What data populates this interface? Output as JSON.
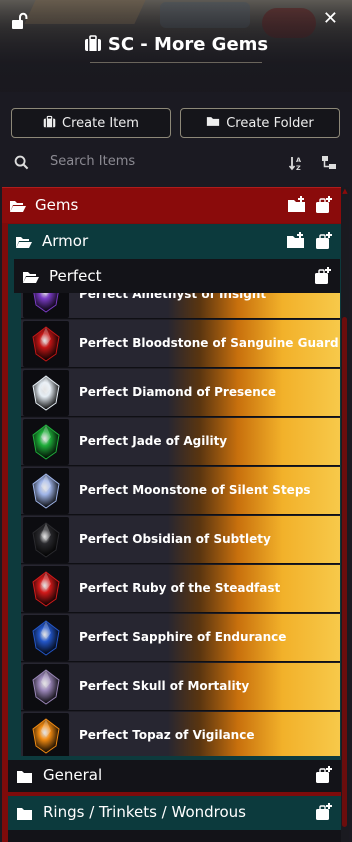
{
  "header": {
    "title": "SC - More Gems"
  },
  "actions": {
    "create_item": "Create Item",
    "create_folder": "Create Folder"
  },
  "search": {
    "placeholder": "Search Items"
  },
  "folders": {
    "gems": "Gems",
    "armor": "Armor",
    "perfect": "Perfect",
    "general": "General",
    "rings": "Rings / Trinkets / Wondrous"
  },
  "items": [
    {
      "name": "Perfect Amethyst of Insight",
      "color": "#7a3cc4"
    },
    {
      "name": "Perfect Bloodstone of Sanguine Guard",
      "color": "#c41616"
    },
    {
      "name": "Perfect Diamond of Presence",
      "color": "#e6eef5"
    },
    {
      "name": "Perfect Jade of Agility",
      "color": "#1fae3a"
    },
    {
      "name": "Perfect Moonstone of Silent Steps",
      "color": "#9fb4e8"
    },
    {
      "name": "Perfect Obsidian of Subtlety",
      "color": "#2a2a2e"
    },
    {
      "name": "Perfect Ruby of the Steadfast",
      "color": "#d21a1a"
    },
    {
      "name": "Perfect Sapphire of Endurance",
      "color": "#2356c8"
    },
    {
      "name": "Perfect Skull of Mortality",
      "color": "#9a86b8"
    },
    {
      "name": "Perfect Topaz of Vigilance",
      "color": "#f08a12"
    }
  ],
  "colors": {
    "gems_folder": "#8a0b0b",
    "armor_folder": "#0c3a3d",
    "item_gradient_end": "#f7c94a"
  }
}
